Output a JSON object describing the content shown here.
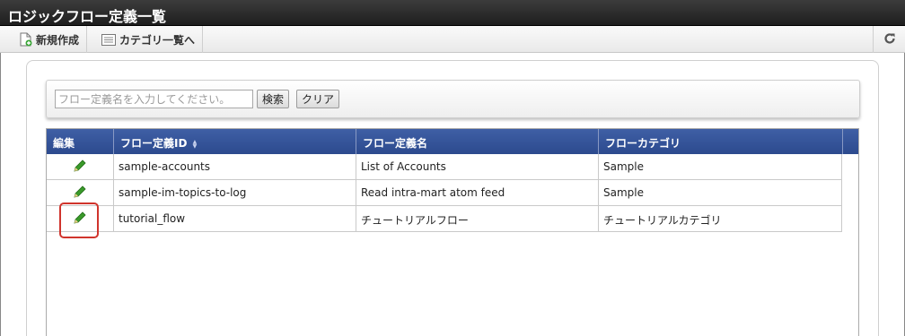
{
  "window": {
    "title": "ロジックフロー定義一覧"
  },
  "toolbar": {
    "new_label": "新規作成",
    "category_label": "カテゴリ一覧へ",
    "refresh_icon": "refresh-icon"
  },
  "search": {
    "placeholder": "フロー定義名を入力してください。",
    "value": "",
    "search_label": "検索",
    "clear_label": "クリア"
  },
  "grid": {
    "columns": [
      "編集",
      "フロー定義ID",
      "フロー定義名",
      "フローカテゴリ"
    ],
    "sorted_column": "フロー定義ID",
    "rows": [
      {
        "id": "sample-accounts",
        "name": "List of Accounts",
        "category": "Sample"
      },
      {
        "id": "sample-im-topics-to-log",
        "name": "Read intra-mart atom feed",
        "category": "Sample"
      },
      {
        "id": "tutorial_flow",
        "name": "チュートリアルフロー",
        "category": "チュートリアルカテゴリ"
      }
    ]
  },
  "colors": {
    "header_blue": "#2c4a8e",
    "title_bar": "#1e1e1e",
    "pencil_green": "#3a9a2a",
    "highlight_red": "#d0342c"
  }
}
